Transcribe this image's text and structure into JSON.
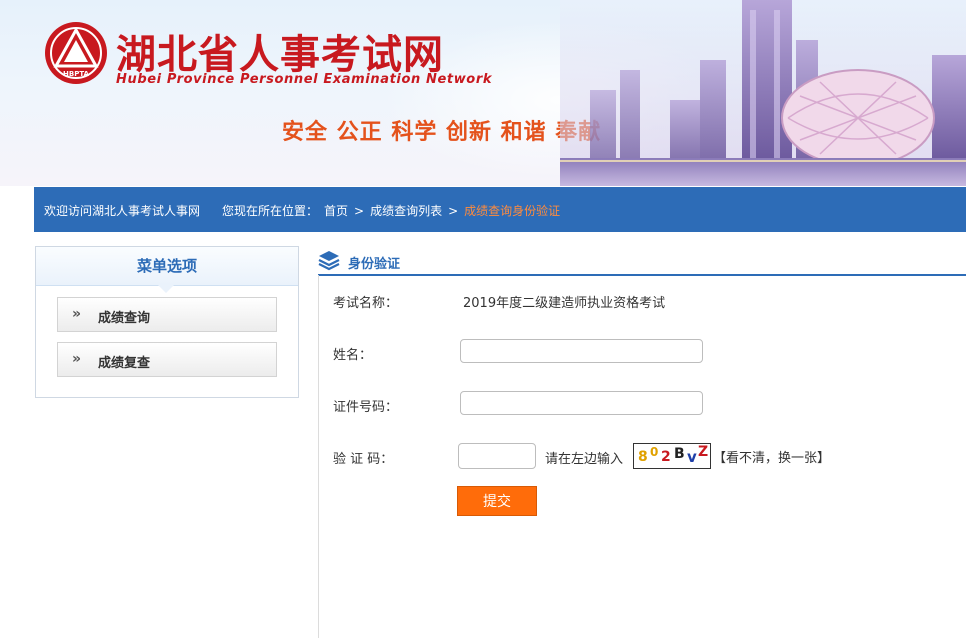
{
  "header": {
    "logo_badge_text": "HBPTA",
    "site_title": "湖北省人事考试网",
    "site_subtitle": "Hubei Province Personnel Examination Network",
    "slogan": "安全 公正 科学 创新 和谐 奉献"
  },
  "nav": {
    "welcome": "欢迎访问湖北人事考试人事网",
    "location_label": "您现在所在位置：",
    "breadcrumb": [
      "首页",
      "成绩查询列表",
      "成绩查询身份验证"
    ],
    "separator": ">"
  },
  "sidebar": {
    "title": "菜单选项",
    "items": [
      {
        "label": "成绩查询"
      },
      {
        "label": "成绩复查"
      }
    ],
    "chevron": "»"
  },
  "main": {
    "section_title": "身份验证",
    "exam_label": "考试名称：",
    "exam_value": "2019年度二级建造师执业资格考试",
    "name_label": "姓名：",
    "name_value": "",
    "id_label": "证件号码：",
    "id_value": "",
    "captcha_label": "验 证 码：",
    "captcha_value": "",
    "captcha_hint": "请在左边输入",
    "captcha_chars": [
      "8",
      "0",
      "2",
      "B",
      "v",
      "Z"
    ],
    "captcha_colors": [
      "#e0a100",
      "#e0a100",
      "#c8191f",
      "#222222",
      "#1f3fa8",
      "#c8191f"
    ],
    "refresh_label": "【看不清，换一张】",
    "submit_label": "提交"
  },
  "colors": {
    "brand_red": "#c8191f",
    "nav_blue": "#2d6cb7",
    "slogan_orange": "#e4521c",
    "crumb_current": "#ff8b3d",
    "submit_orange": "#ff6c0a"
  }
}
